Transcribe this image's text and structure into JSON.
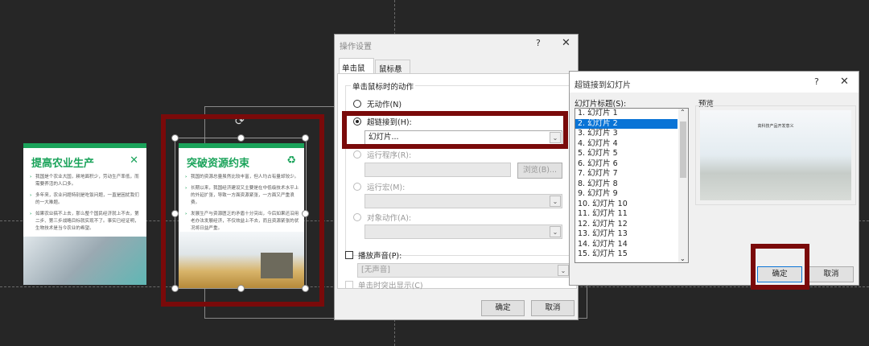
{
  "cards": [
    {
      "title": "提高农业生产",
      "icon": "dna-icon",
      "bullets": [
        "我国是个农业大国，耕地面积少，劳动生产率低，而需要养活的人口多。",
        "多年来，农业问题特别是吃饭问题，一直是困扰我们的一大难题。",
        "如果农业搞不上去，那么整个国民经济就上不去，第二步、第三步战略目标就实现不了。事实已经证明，生物技术是当今农业的希望。"
      ]
    },
    {
      "title": "突破资源约束",
      "icon": "resource-icon",
      "bullets": [
        "我国的资源总量虽然比较丰富，但人均占有量却较少。",
        "长期以来，我国经济建设又主要是在中低级技术水平上的外延扩张，导致一方面资源紧张，一方面又严重浪费。",
        "发展生产与资源匮乏的矛盾十分突出，今后如果还沿用老办法发展经济，不仅效益上不去，而且资源紧张的状况将日益严重。"
      ]
    }
  ],
  "action_dialog": {
    "title": "操作设置",
    "help": "?",
    "close": "✕",
    "tabs": [
      "单击鼠标",
      "鼠标悬停"
    ],
    "group_label": "单击鼠标时的动作",
    "none": "无动作(N)",
    "hyperlink": "超链接到(H):",
    "hyperlink_value": "幻灯片...",
    "run_program": "运行程序(R):",
    "browse": "浏览(B)...",
    "run_macro": "运行宏(M):",
    "object_action": "对象动作(A):",
    "play_sound": "播放声音(P):",
    "sound_value": "[无声音]",
    "highlight": "单击时突出显示(C)",
    "ok": "确定",
    "cancel": "取消"
  },
  "slide_dialog": {
    "title": "超链接到幻灯片",
    "help": "?",
    "close": "✕",
    "list_label": "幻灯片标题(S):",
    "preview_label": "预览",
    "preview_slide_title": "高科技产品开发意义",
    "slides": [
      "1. 幻灯片 1",
      "2. 幻灯片 2",
      "3. 幻灯片 3",
      "4. 幻灯片 4",
      "5. 幻灯片 5",
      "6. 幻灯片 6",
      "7. 幻灯片 7",
      "8. 幻灯片 8",
      "9. 幻灯片 9",
      "10. 幻灯片 10",
      "11. 幻灯片 11",
      "12. 幻灯片 12",
      "13. 幻灯片 13",
      "14. 幻灯片 14",
      "15. 幻灯片 15"
    ],
    "selected_index": 1,
    "ok": "确定",
    "cancel": "取消"
  }
}
